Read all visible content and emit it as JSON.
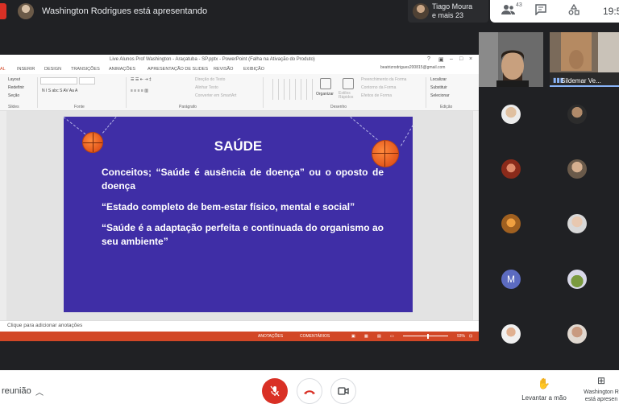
{
  "topbar": {
    "presenter_text": "Washington Rodrigues está apresentando",
    "tiago_name": "Tiago Moura",
    "tiago_sub": "e mais 23",
    "participant_count": "43",
    "time": "19:5"
  },
  "ppt": {
    "title": "Live Alunos Prof Washington - Araçatuba - SP.pptx - PowerPoint (Falha na Ativação do Produto)",
    "email": "beatrizrodrigues200815@gmail.com",
    "tabs": [
      "AL",
      "INSERIR",
      "DESIGN",
      "TRANSIÇÕES",
      "ANIMAÇÕES",
      "APRESENTAÇÃO DE SLIDES",
      "REVISÃO",
      "EXIBIÇÃO"
    ],
    "ribbon": {
      "layout": "Layout",
      "redefinir": "Redefinir",
      "secao": "Seção",
      "slides_group": "Slides",
      "fonte_group": "Fonte",
      "paragrafo_group": "Parágrafo",
      "desenho_group": "Desenho",
      "edicao_group": "Edição",
      "direcao_texto": "Direção do Texto",
      "alinhar_texto": "Alinhar Texto",
      "converter": "Converter em SmartArt",
      "organizar": "Organizar",
      "estilos_label": "Estilos Rápidos",
      "preenchimento": "Preenchimento da Forma",
      "contorno": "Contorno da Forma",
      "efeitos": "Efeitos de Forma",
      "localizar": "Localizar",
      "substituir": "Substituir",
      "selecionar": "Selecionar"
    },
    "slide": {
      "title": "SAÚDE",
      "line1": "Conceitos; “Saúde é ausência de doença” ou o oposto de doença",
      "line2": "“Estado completo de bem-estar físico, mental e social”",
      "line3": "“Saúde é a adaptação perfeita e continuada do organismo ao seu ambiente”"
    },
    "notes_placeholder": "Clique para adicionar anotações",
    "status": {
      "anotacoes": "ANOTAÇÕES",
      "comentarios": "COMENTÁRIOS",
      "zoom": "93%"
    }
  },
  "participants": {
    "main_name": "Sildemar Ve...",
    "letter_avatar": "M"
  },
  "bottombar": {
    "meeting_details": "reunião",
    "raise_hand": "Levantar a mão",
    "present_line1": "Washington R",
    "present_line2": "está apresen"
  },
  "colors": {
    "slide_bg": "#3f2ea6",
    "accent_red": "#d93025",
    "ppt_orange": "#d24726"
  }
}
